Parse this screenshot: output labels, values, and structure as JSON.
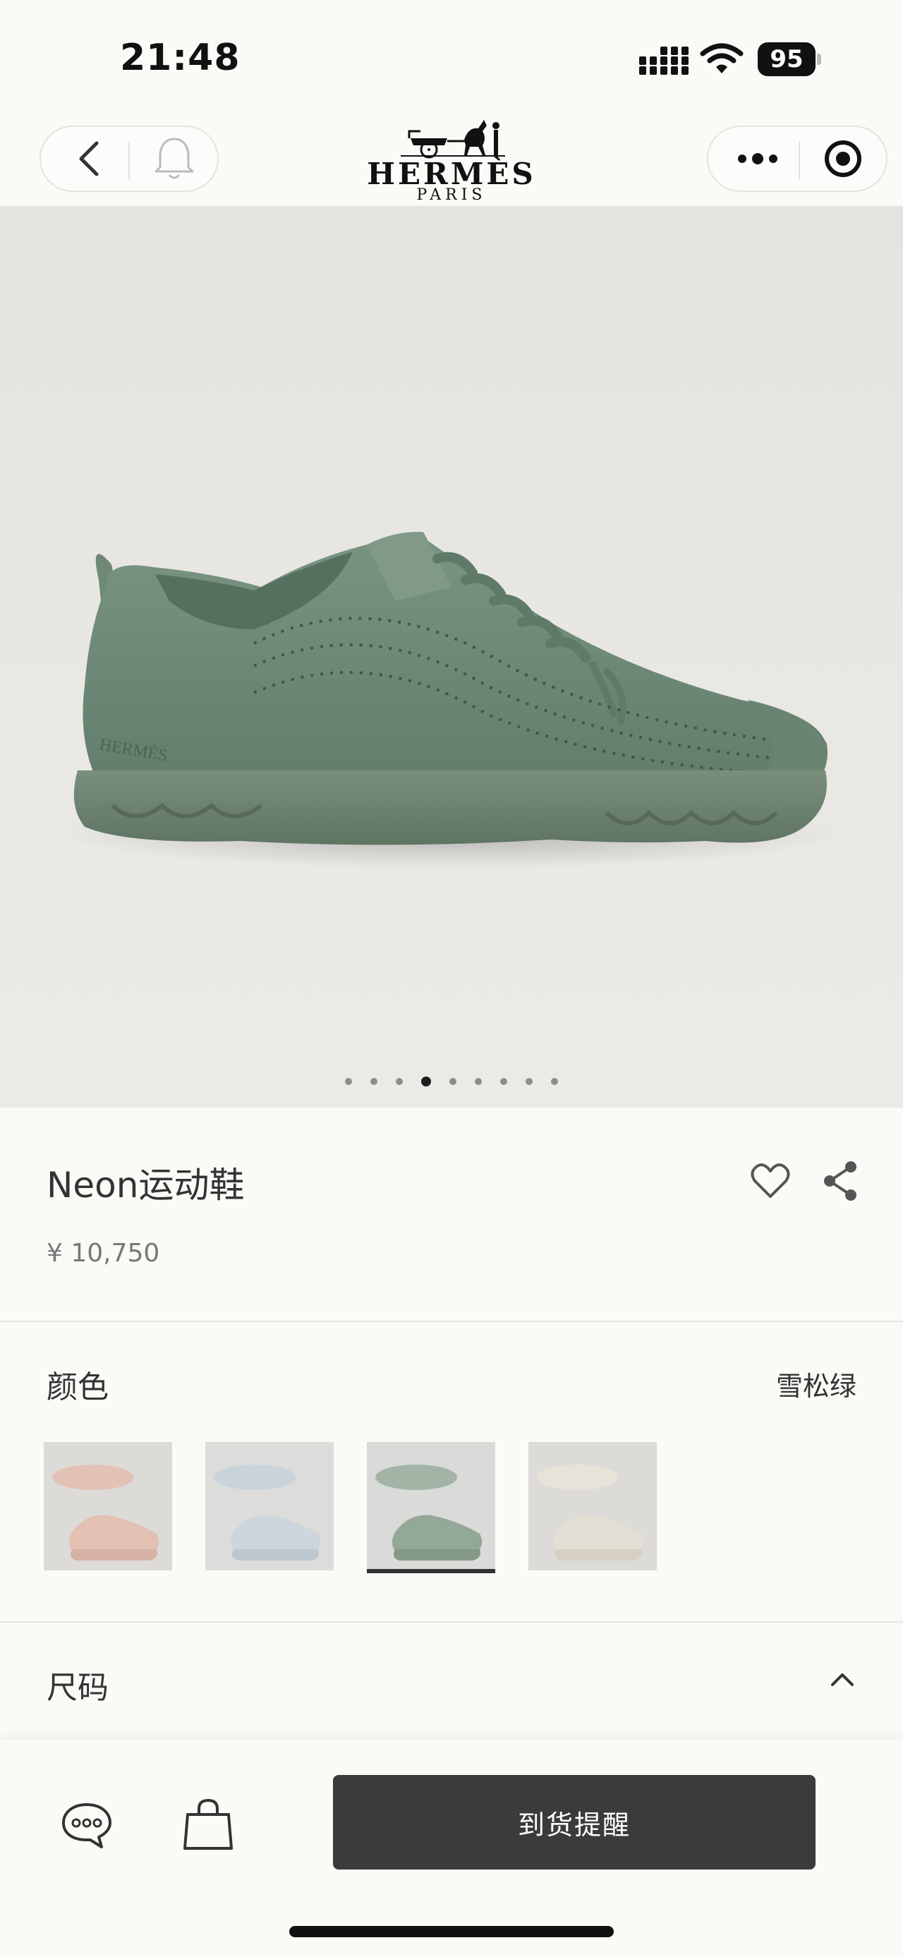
{
  "status_bar": {
    "time": "21:48",
    "battery": "95"
  },
  "nav": {
    "back_icon": "chevron-left-icon",
    "bell_icon": "bell-icon",
    "more_icon": "more-dots-icon",
    "target_icon": "target-icon"
  },
  "brand": {
    "name": "HERMÈS",
    "sub": "PARIS"
  },
  "gallery": {
    "dot_count": 9,
    "active_index": 3
  },
  "product": {
    "title": "Neon运动鞋",
    "price": "¥ 10,750"
  },
  "color": {
    "label": "颜色",
    "selected": "雪松绿",
    "swatches": [
      {
        "tone": "#e6c7bc"
      },
      {
        "tone": "#cfd6dd"
      },
      {
        "tone": "#9aab9e"
      },
      {
        "tone": "#e2ddd2"
      }
    ],
    "selected_index": 2
  },
  "size": {
    "label": "尺码"
  },
  "actions": {
    "notify_label": "到货提醒"
  },
  "colors": {
    "shoe_upper": "#6f8a78",
    "shoe_sole": "#6e8472",
    "button_bg": "#3b3b3b"
  }
}
